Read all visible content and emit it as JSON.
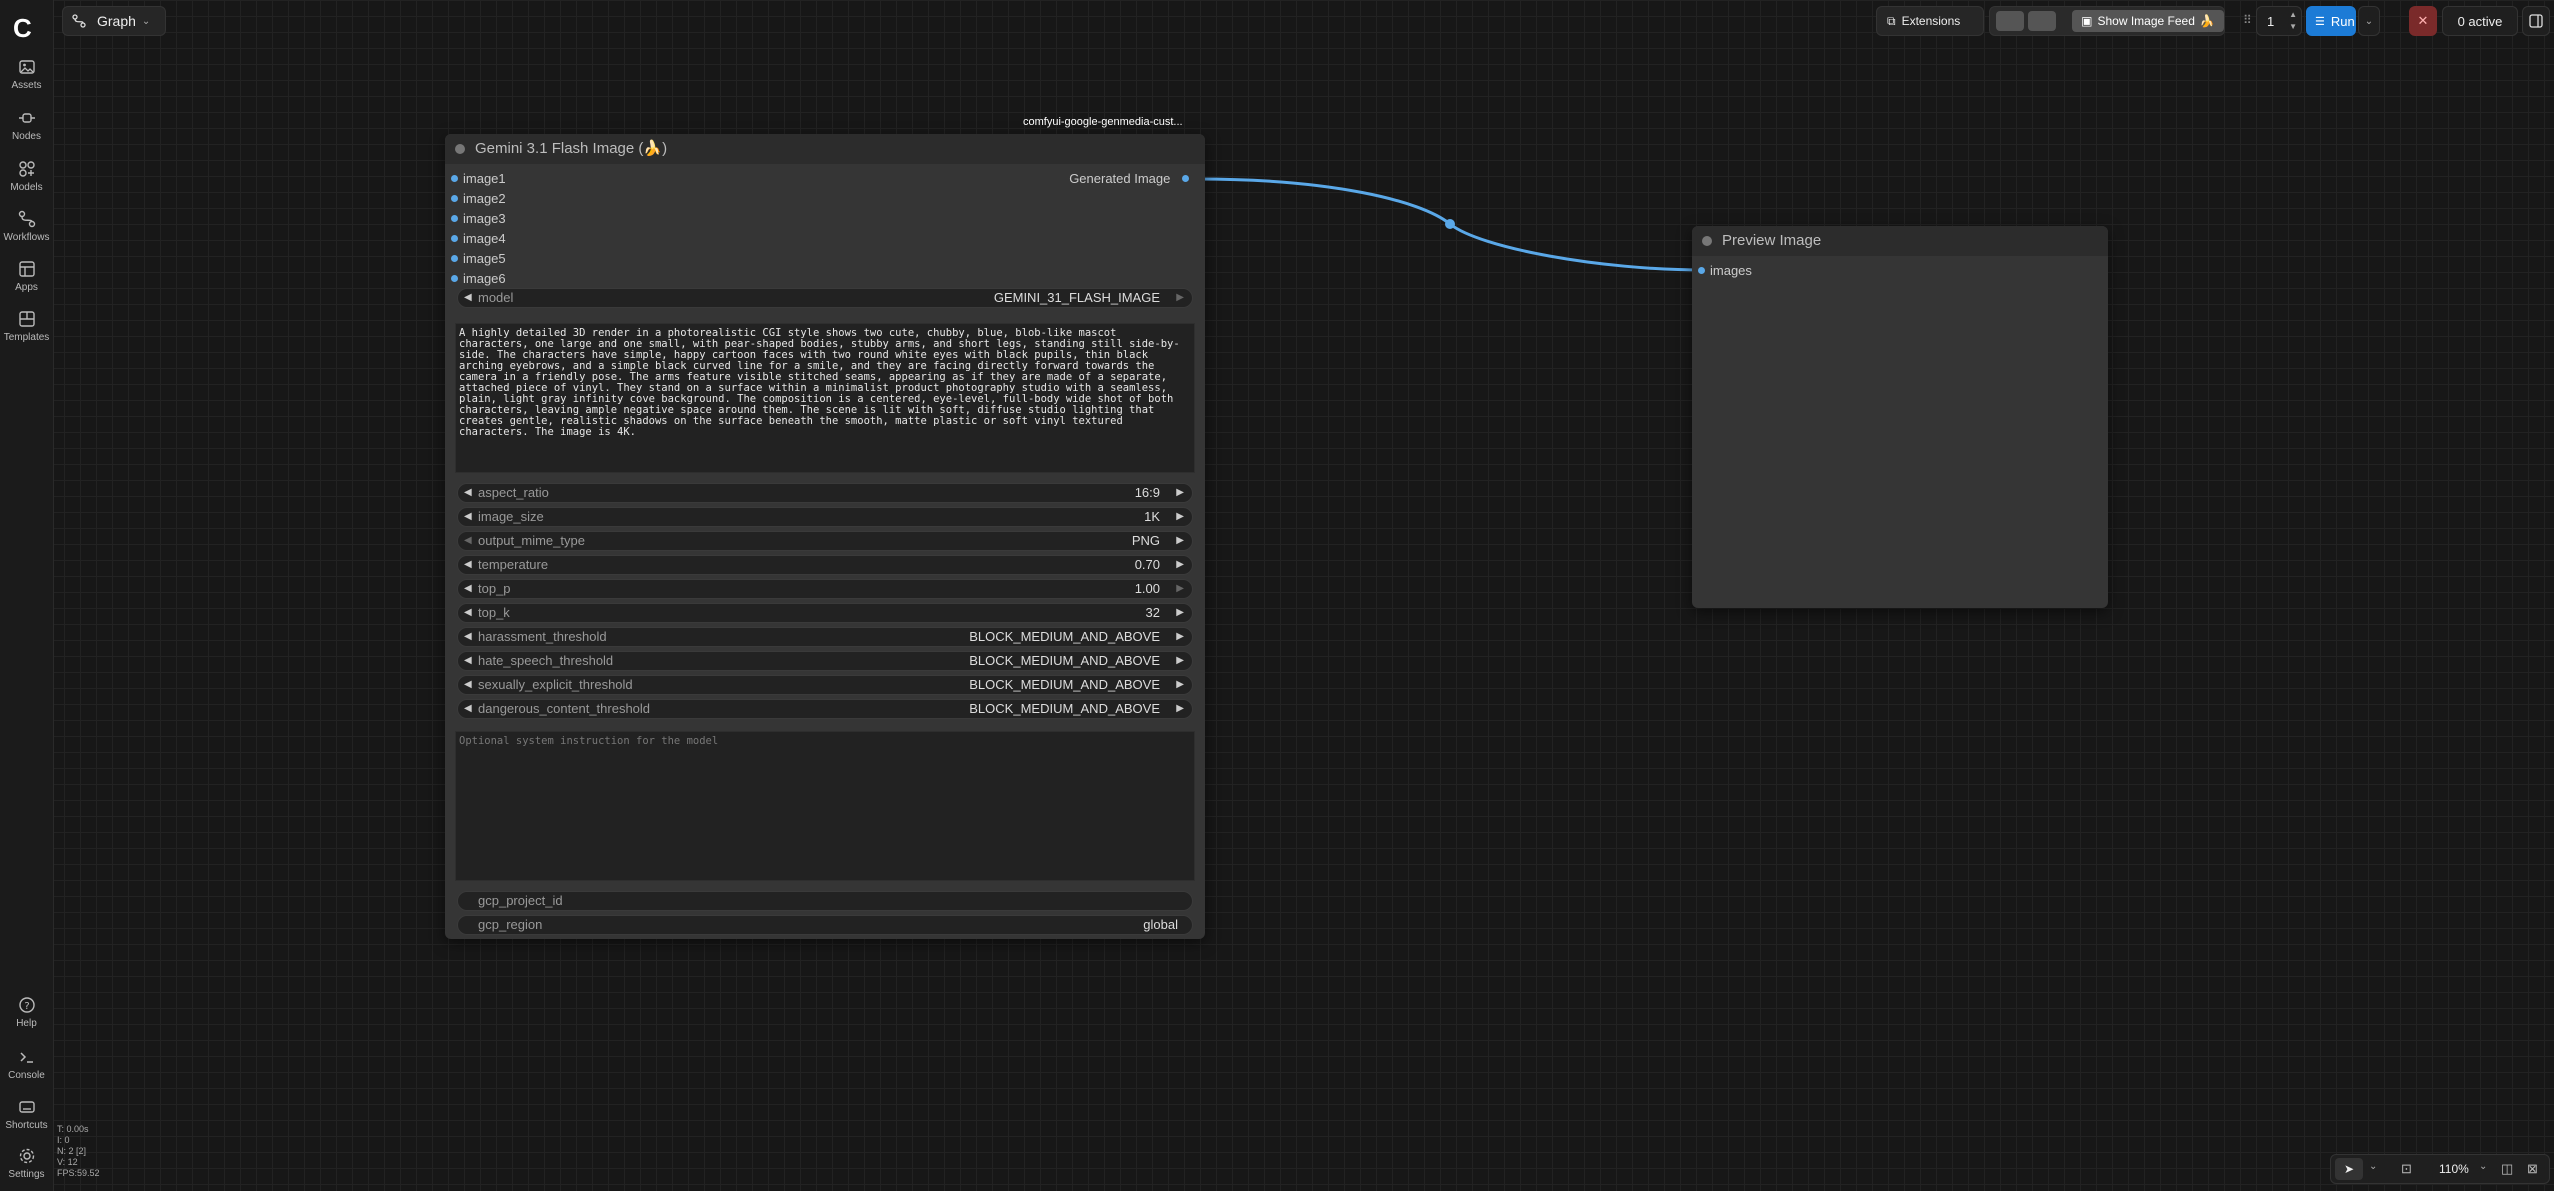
{
  "sidebar": {
    "items": [
      {
        "label": "Assets",
        "icon": "image-icon"
      },
      {
        "label": "Nodes",
        "icon": "node-icon"
      },
      {
        "label": "Models",
        "icon": "models-icon"
      },
      {
        "label": "Workflows",
        "icon": "workflow-icon"
      },
      {
        "label": "Apps",
        "icon": "apps-icon"
      },
      {
        "label": "Templates",
        "icon": "templates-icon"
      }
    ],
    "bottom": [
      {
        "label": "Help",
        "icon": "help-icon"
      },
      {
        "label": "Console",
        "icon": "console-icon"
      },
      {
        "label": "Shortcuts",
        "icon": "keyboard-icon"
      },
      {
        "label": "Settings",
        "icon": "gear-icon"
      }
    ]
  },
  "stats": {
    "t": "T: 0.00s",
    "i": "I: 0",
    "n": "N: 2 [2]",
    "v": "V: 12",
    "fps": "FPS:59.52"
  },
  "topbar": {
    "graph_label": "Graph",
    "extensions_label": "Extensions",
    "show_image_feed_label": "Show Image Feed",
    "queue_count": "1",
    "run_label": "Run",
    "active_label": "0 active"
  },
  "bottombar": {
    "zoom": "110%"
  },
  "gemini_node": {
    "badge": "comfyui-google-genmedia-cust...",
    "title": "Gemini 3.1 Flash Image (🍌)",
    "inputs": [
      "image1",
      "image2",
      "image3",
      "image4",
      "image5",
      "image6"
    ],
    "output": "Generated Image",
    "model": {
      "label": "model",
      "value": "GEMINI_31_FLASH_IMAGE"
    },
    "prompt": "A highly detailed 3D render in a photorealistic CGI style shows two cute, chubby, blue, blob-like mascot characters, one large and one small, with pear-shaped bodies, stubby arms, and short legs, standing still side-by-side. The characters have simple, happy cartoon faces with two round white eyes with black pupils, thin black arching eyebrows, and a simple black curved line for a smile, and they are facing directly forward towards the camera in a friendly pose. The arms feature visible stitched seams, appearing as if they are made of a separate, attached piece of vinyl. They stand on a surface within a minimalist product photography studio with a seamless, plain, light gray infinity cove background. The composition is a centered, eye-level, full-body wide shot of both characters, leaving ample negative space around them. The scene is lit with soft, diffuse studio lighting that creates gentle, realistic shadows on the surface beneath the smooth, matte plastic or soft vinyl textured characters. The image is 4K.",
    "params": [
      {
        "label": "aspect_ratio",
        "value": "16:9"
      },
      {
        "label": "image_size",
        "value": "1K"
      },
      {
        "label": "output_mime_type",
        "value": "PNG"
      },
      {
        "label": "temperature",
        "value": "0.70"
      },
      {
        "label": "top_p",
        "value": "1.00"
      },
      {
        "label": "top_k",
        "value": "32"
      },
      {
        "label": "harassment_threshold",
        "value": "BLOCK_MEDIUM_AND_ABOVE"
      },
      {
        "label": "hate_speech_threshold",
        "value": "BLOCK_MEDIUM_AND_ABOVE"
      },
      {
        "label": "sexually_explicit_threshold",
        "value": "BLOCK_MEDIUM_AND_ABOVE"
      },
      {
        "label": "dangerous_content_threshold",
        "value": "BLOCK_MEDIUM_AND_ABOVE"
      }
    ],
    "system_placeholder": "Optional system instruction for the model",
    "gcp_project_id": {
      "label": "gcp_project_id",
      "value": ""
    },
    "gcp_region": {
      "label": "gcp_region",
      "value": "global"
    }
  },
  "preview_node": {
    "title": "Preview Image",
    "input": "images"
  },
  "colors": {
    "accent": "#1c7bd6",
    "link": "#5aa8e8",
    "cancel": "#7a2a2a"
  }
}
